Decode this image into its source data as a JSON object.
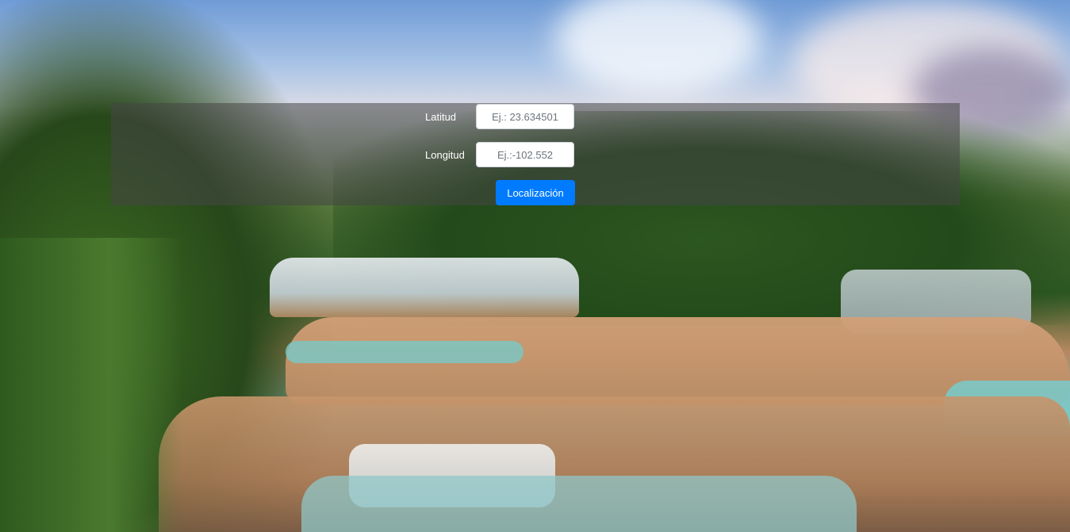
{
  "form": {
    "latitude": {
      "label": "Latitud",
      "placeholder": "Ej.: 23.634501",
      "value": ""
    },
    "longitude": {
      "label": "Longitud",
      "placeholder": "Ej.:-102.552",
      "value": ""
    },
    "submit_label": "Localización"
  },
  "colors": {
    "button_primary": "#007bff",
    "overlay": "rgba(70,70,70,0.55)",
    "label_text": "#ffffff"
  }
}
